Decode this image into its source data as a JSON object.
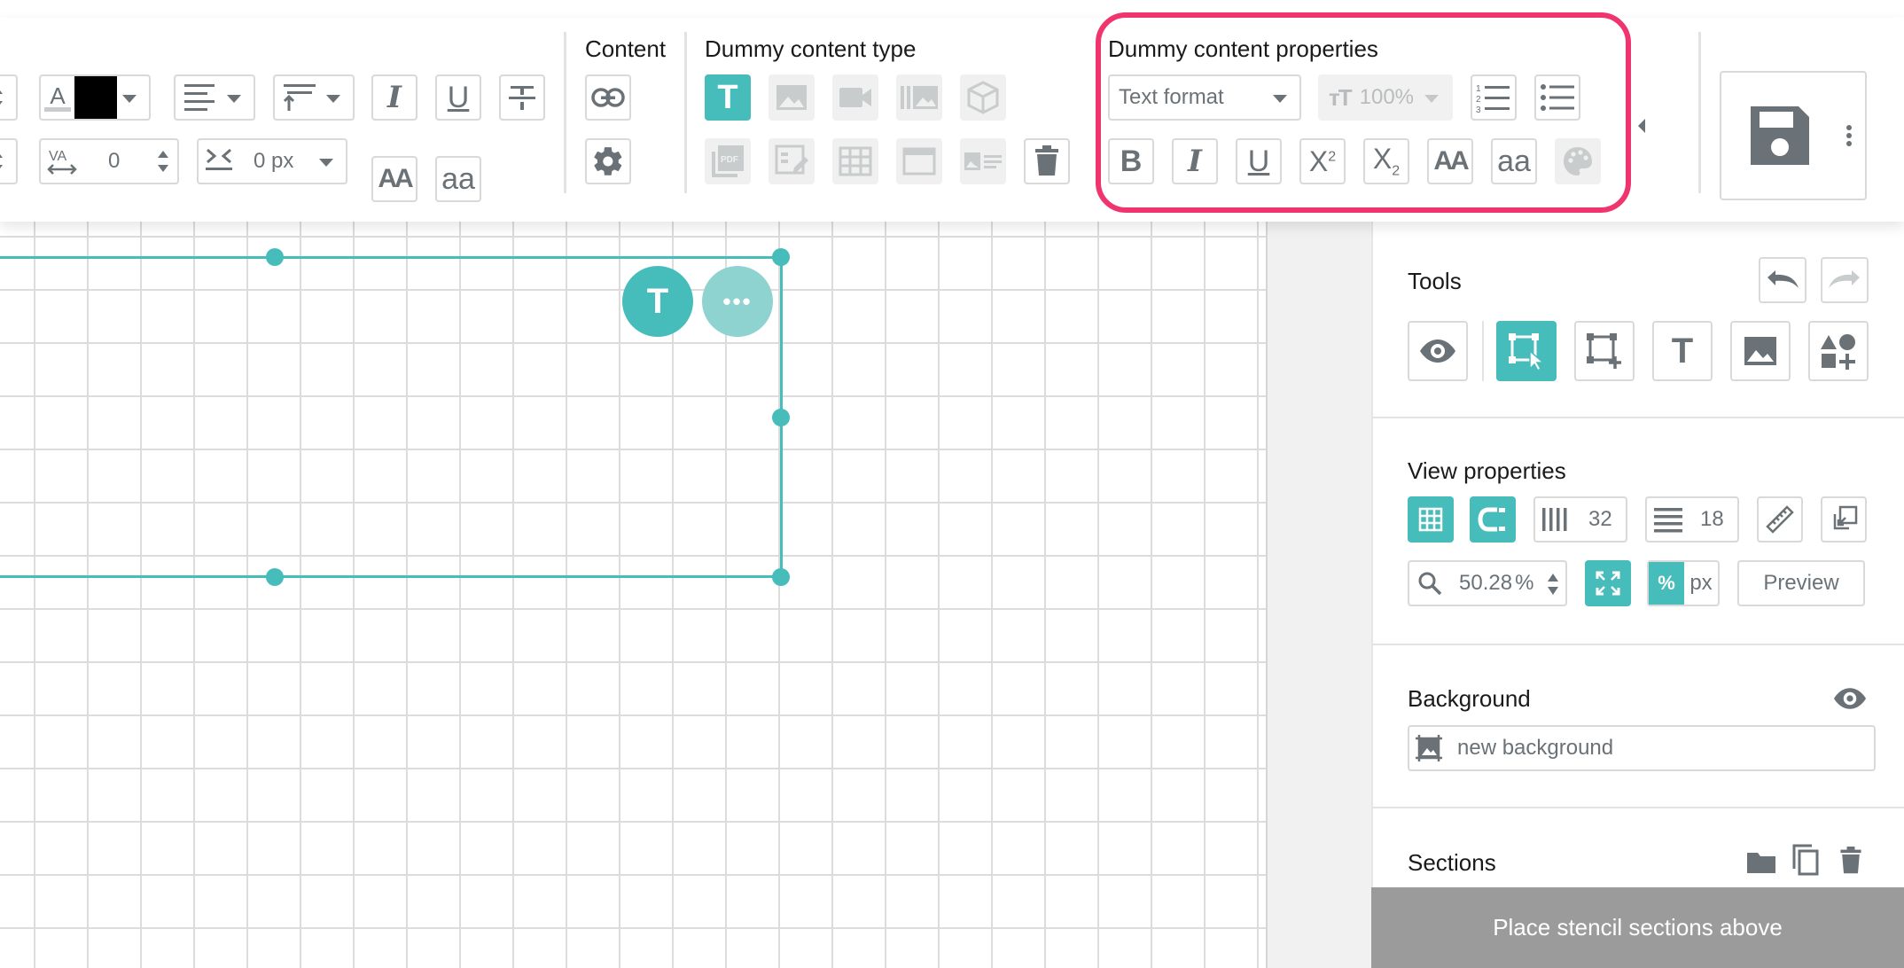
{
  "toolbar": {
    "sections": {
      "content": "Content",
      "dummy_type": "Dummy content type",
      "dummy_props": "Dummy content properties"
    },
    "letter_spacing_value": "0",
    "line_spacing_value": "0 px",
    "text_format_placeholder": "Text format",
    "font_scale_value": "100%",
    "text_color": "#000000"
  },
  "canvas": {
    "element_badge": "T",
    "more_badge": "•••"
  },
  "panel": {
    "tools_title": "Tools",
    "view_properties_title": "View properties",
    "columns_value": "32",
    "rows_value": "18",
    "zoom_value": "50.28",
    "zoom_unit": "%",
    "unit_percent": "%",
    "unit_px": "px",
    "preview_label": "Preview",
    "background_title": "Background",
    "background_value": "new background",
    "sections_title": "Sections",
    "footer_text": "Place stencil sections above"
  },
  "colors": {
    "accent": "#47bdbb",
    "highlight": "#f0346d",
    "icon": "#6b7277"
  }
}
